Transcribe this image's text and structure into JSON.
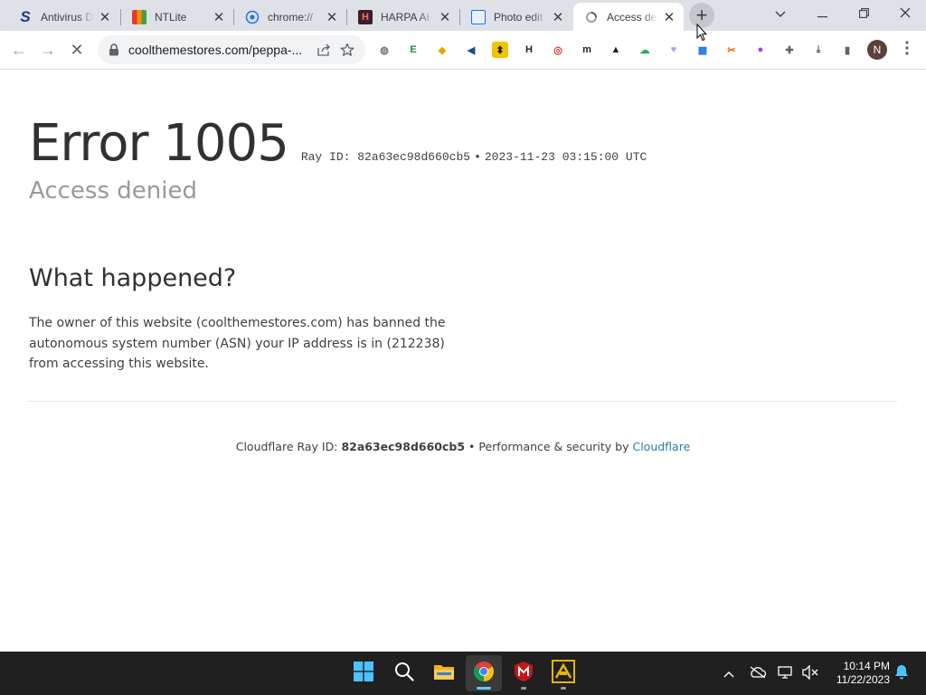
{
  "tabs": [
    {
      "title": "Antivirus D",
      "icon": "s-logo-icon",
      "active": false
    },
    {
      "title": "NTLite",
      "icon": "ntlite-icon",
      "active": false
    },
    {
      "title": "chrome://",
      "icon": "chrome-page-icon",
      "active": false
    },
    {
      "title": "HARPA AI",
      "icon": "harpa-icon",
      "active": false
    },
    {
      "title": "Photo edit",
      "icon": "photo-editor-icon",
      "active": false
    },
    {
      "title": "Access der",
      "icon": "loading-icon",
      "active": true
    }
  ],
  "window": {
    "minimize": "—",
    "restore": "❐",
    "close": "✕",
    "tab_search": "⌄",
    "new_tab": "+"
  },
  "toolbar": {
    "back": "←",
    "forward": "→",
    "reload": "✕",
    "url": "coolthemestores.com/peppa-...",
    "avatar_letter": "N"
  },
  "extensions": [
    {
      "name": "globe-extension-icon",
      "glyph": "◍",
      "bg": "#ffffff",
      "fg": "#777777"
    },
    {
      "name": "evernote-extension-icon",
      "glyph": "E",
      "bg": "#ffffff",
      "fg": "#1e8e3e"
    },
    {
      "name": "shield-extension-icon",
      "glyph": "◆",
      "bg": "#ffffff",
      "fg": "#e0a800"
    },
    {
      "name": "megaphone-extension-icon",
      "glyph": "◀",
      "bg": "#ffffff",
      "fg": "#1a4e8a"
    },
    {
      "name": "arrows-extension-icon",
      "glyph": "⬍",
      "bg": "#f5c400",
      "fg": "#202020"
    },
    {
      "name": "harpa-extension-icon",
      "glyph": "H",
      "bg": "#ffffff",
      "fg": "#202020"
    },
    {
      "name": "target-extension-icon",
      "glyph": "◎",
      "bg": "#ffffff",
      "fg": "#d93025"
    },
    {
      "name": "m-extension-icon",
      "glyph": "m",
      "bg": "#ffffff",
      "fg": "#202020"
    },
    {
      "name": "mask-extension-icon",
      "glyph": "▲",
      "bg": "#ffffff",
      "fg": "#202020"
    },
    {
      "name": "cloud-extension-icon",
      "glyph": "☁",
      "bg": "#ffffff",
      "fg": "#34a853"
    },
    {
      "name": "heart-extension-icon",
      "glyph": "♥",
      "bg": "#ffffff",
      "fg": "#9fa8da"
    },
    {
      "name": "image-extension-icon",
      "glyph": "▦",
      "bg": "#ffffff",
      "fg": "#1a73e8"
    },
    {
      "name": "scissors-extension-icon",
      "glyph": "✂",
      "bg": "#ffffff",
      "fg": "#e8710a"
    },
    {
      "name": "color-extension-icon",
      "glyph": "●",
      "bg": "#ffffff",
      "fg": "#a142f4"
    },
    {
      "name": "puzzle-extensions-icon",
      "glyph": "✚",
      "bg": "#ffffff",
      "fg": "#5f6368"
    },
    {
      "name": "download-icon",
      "glyph": "⤓",
      "bg": "#ffffff",
      "fg": "#5f6368"
    },
    {
      "name": "side-panel-icon",
      "glyph": "▮",
      "bg": "#ffffff",
      "fg": "#5f6368"
    }
  ],
  "page": {
    "error_title": "Error 1005",
    "ray_label": "Ray ID: 82a63ec98d660cb5",
    "ray_dot": "•",
    "timestamp": "2023-11-23 03:15:00 UTC",
    "subtitle": "Access denied",
    "what_heading": "What happened?",
    "what_text": "The owner of this website (coolthemestores.com) has banned the autonomous system number (ASN) your IP address is in (212238) from accessing this website.",
    "footer_prefix": "Cloudflare Ray ID: ",
    "footer_ray": "82a63ec98d660cb5",
    "footer_sep": " • ",
    "footer_perf": "Performance & security by ",
    "footer_link": "Cloudflare"
  },
  "taskbar": {
    "apps": [
      "windows-start-icon",
      "search-icon",
      "file-explorer-icon",
      "chrome-icon",
      "mcafee-icon",
      "ntlite-app-icon"
    ],
    "time": "10:14 PM",
    "date": "11/22/2023"
  },
  "colors": {
    "link": "#2c7cb0",
    "taskbar": "#202020",
    "tabstrip": "#dee1e6"
  }
}
